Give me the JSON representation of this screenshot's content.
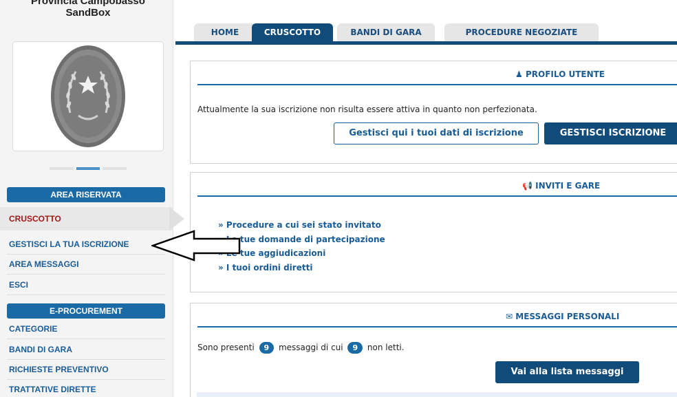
{
  "sidebar": {
    "org_name_line1": "Provincia Campobasso",
    "org_name_line2": "SandBox",
    "logo_icon": "crest-emblem-icon",
    "area_riservata": {
      "heading": "AREA RISERVATA",
      "items": [
        {
          "label": "CRUSCOTTO",
          "active": true
        },
        {
          "label": "GESTISCI LA TUA ISCRIZIONE"
        },
        {
          "label": "AREA MESSAGGI"
        },
        {
          "label": "ESCI"
        }
      ]
    },
    "eprocurement": {
      "heading": "E-PROCUREMENT",
      "items": [
        {
          "label": "CATEGORIE"
        },
        {
          "label": "BANDI DI GARA"
        },
        {
          "label": "RICHIESTE PREVENTIVO"
        },
        {
          "label": "TRATTATIVE DIRETTE"
        }
      ]
    }
  },
  "tabs": [
    {
      "label": "HOME"
    },
    {
      "label": "CRUSCOTTO",
      "active": true
    },
    {
      "label": "BANDI DI GARA"
    },
    {
      "label": "PROCEDURE NEGOZIATE"
    }
  ],
  "profilo": {
    "title": "PROFILO UTENTE",
    "icon": "user-icon",
    "message": "Attualmente la sua iscrizione non risulta essere attiva in quanto non perfezionata.",
    "btn_manage_data": "Gestisci qui i tuoi dati di iscrizione",
    "btn_manage": "GESTISCI ISCRIZIONE"
  },
  "inviti": {
    "title": "INVITI E GARE",
    "icon": "megaphone-icon",
    "links": [
      "» Procedure a cui sei stato invitato",
      "» Le tue domande di partecipazione",
      "» Le tue aggiudicazioni",
      "» I tuoi ordini diretti"
    ]
  },
  "messaggi": {
    "title": "MESSAGGI PERSONALI",
    "icon": "envelope-icon",
    "text_before": "Sono presenti",
    "total": "9",
    "text_middle": "messaggi di cui",
    "unread": "9",
    "text_after": "non letti.",
    "btn_list": "Vai alla lista messaggi"
  },
  "colors": {
    "primary": "#114b7a",
    "accent": "#1a6aa5",
    "active_menu": "#a01818"
  }
}
